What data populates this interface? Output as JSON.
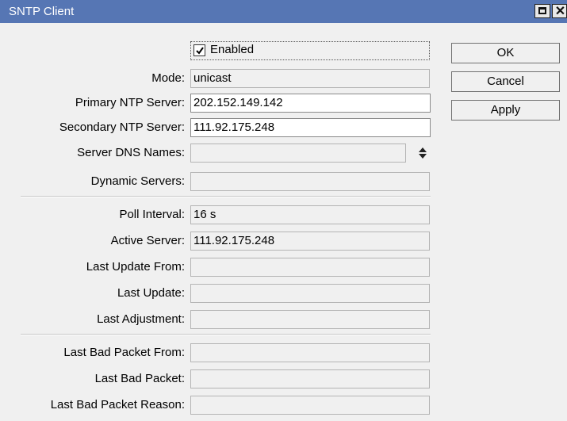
{
  "window": {
    "title": "SNTP Client"
  },
  "titlebar_icons": {
    "maximize": "maximize-icon",
    "close": "close-icon",
    "close_glyph": "✕"
  },
  "enabled": {
    "label": "Enabled",
    "checked": true
  },
  "fields": [
    {
      "label": "Mode:",
      "value": "unicast",
      "editable": false
    },
    {
      "label": "Primary NTP Server:",
      "value": "202.152.149.142",
      "editable": true
    },
    {
      "label": "Secondary NTP Server:",
      "value": "111.92.175.248",
      "editable": true
    },
    {
      "label": "Server DNS Names:",
      "value": "",
      "editable": false
    },
    {
      "label": "Dynamic Servers:",
      "value": "",
      "editable": false
    },
    {
      "label": "Poll Interval:",
      "value": "16 s",
      "editable": false
    },
    {
      "label": "Active Server:",
      "value": "111.92.175.248",
      "editable": false
    },
    {
      "label": "Last Update From:",
      "value": "",
      "editable": false
    },
    {
      "label": "Last Update:",
      "value": "",
      "editable": false
    },
    {
      "label": "Last Adjustment:",
      "value": "",
      "editable": false
    },
    {
      "label": "Last Bad Packet From:",
      "value": "",
      "editable": false
    },
    {
      "label": "Last Bad Packet:",
      "value": "",
      "editable": false
    },
    {
      "label": "Last Bad Packet Reason:",
      "value": "",
      "editable": false
    }
  ],
  "buttons": {
    "ok": "OK",
    "cancel": "Cancel",
    "apply": "Apply"
  },
  "colors": {
    "titlebar": "#5676b4",
    "window_bg": "#f0f0f0"
  }
}
